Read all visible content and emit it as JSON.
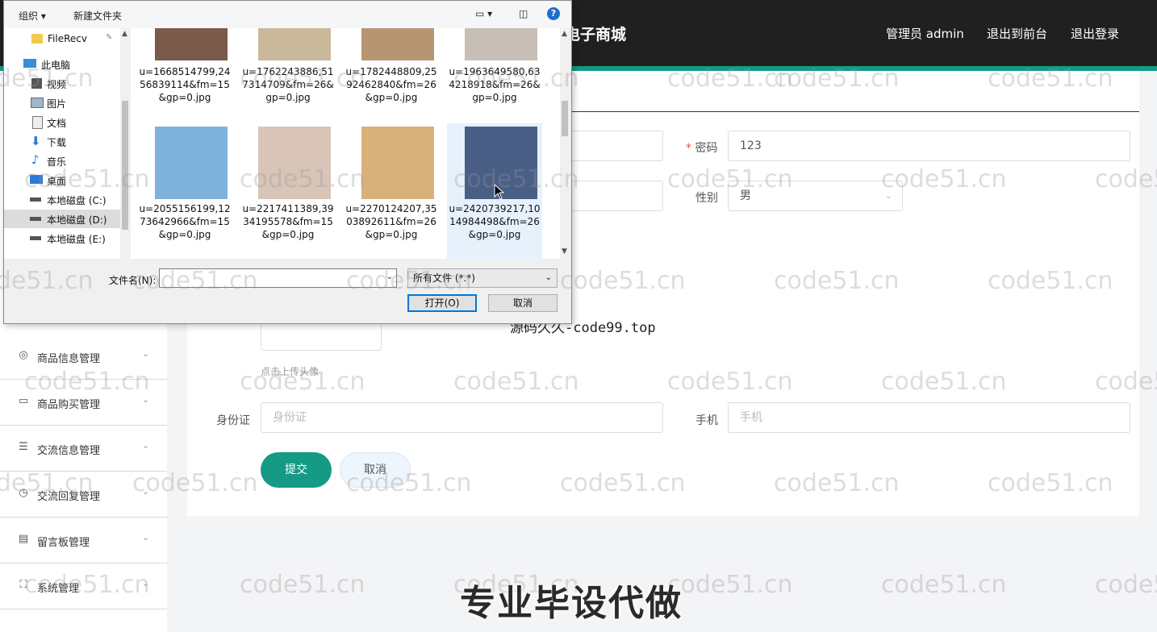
{
  "header": {
    "brand": "电子商城",
    "links": [
      "管理员 admin",
      "退出到前台",
      "退出登录"
    ]
  },
  "sidebar": {
    "items": [
      {
        "label": "商品信息管理",
        "icon": "compass-icon"
      },
      {
        "label": "商品购买管理",
        "icon": "card-icon"
      },
      {
        "label": "交流信息管理",
        "icon": "list-icon"
      },
      {
        "label": "交流回复管理",
        "icon": "clock-icon"
      },
      {
        "label": "留言板管理",
        "icon": "message-icon"
      },
      {
        "label": "系统管理",
        "icon": "grid-icon"
      }
    ]
  },
  "form": {
    "password_label": "密码",
    "password_value": "123",
    "gender_label": "性别",
    "gender_value": "男",
    "upload_hint": "点击上传头像",
    "id_label": "身份证",
    "id_placeholder": "身份证",
    "phone_label": "手机",
    "phone_placeholder": "手机",
    "submit_label": "提交",
    "cancel_label": "取消"
  },
  "dialog": {
    "toolbar": {
      "organize": "组织 ▾",
      "new_folder": "新建文件夹"
    },
    "nav": [
      {
        "label": "FileRecv",
        "icon": "folder-icon"
      },
      {
        "label": "此电脑",
        "icon": "computer-icon"
      },
      {
        "label": "视频",
        "icon": "video-icon"
      },
      {
        "label": "图片",
        "icon": "picture-icon"
      },
      {
        "label": "文档",
        "icon": "document-icon"
      },
      {
        "label": "下载",
        "icon": "download-icon"
      },
      {
        "label": "音乐",
        "icon": "music-icon"
      },
      {
        "label": "桌面",
        "icon": "desktop-icon"
      },
      {
        "label": "本地磁盘 (C:)",
        "icon": "drive-icon"
      },
      {
        "label": "本地磁盘 (D:)",
        "icon": "drive-icon"
      },
      {
        "label": "本地磁盘 (E:)",
        "icon": "drive-icon"
      }
    ],
    "files": [
      {
        "name": "u=1668514799,2456839114&fm=15&gp=0.jpg",
        "color": "#7a5a4a"
      },
      {
        "name": "u=1762243886,517314709&fm=26&gp=0.jpg",
        "color": "#c9b99a"
      },
      {
        "name": "u=1782448809,2592462840&fm=26&gp=0.jpg",
        "color": "#b59572"
      },
      {
        "name": "u=1963649580,634218918&fm=26&gp=0.jpg",
        "color": "#c7bfb5"
      },
      {
        "name": "u=2055156199,1273642966&fm=15&gp=0.jpg",
        "color": "#7fb3dc"
      },
      {
        "name": "u=2217411389,3934195578&fm=15&gp=0.jpg",
        "color": "#d9c4b8"
      },
      {
        "name": "u=2270124207,3503892611&fm=26&gp=0.jpg",
        "color": "#d8b07a"
      },
      {
        "name": "u=2420739217,1014984498&fm=26&gp=0.jpg",
        "color": "#4a5f86"
      }
    ],
    "filename_label": "文件名(N):",
    "filetype": "所有文件 (*.*)",
    "open_label": "打开(O)",
    "cancel_label": "取消"
  },
  "watermark": "code51.cn",
  "source_text": "源码久久-code99.top",
  "promo_text": "专业毕设代做"
}
